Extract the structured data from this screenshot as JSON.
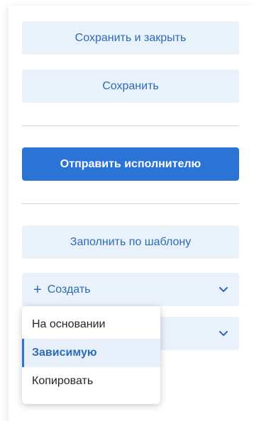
{
  "actions": {
    "save_close_label": "Сохранить и закрыть",
    "save_label": "Сохранить",
    "send_label": "Отправить исполнителю",
    "fill_template_label": "Заполнить по шаблону"
  },
  "create_dropdown": {
    "plus": "+",
    "label": "Создать"
  },
  "second_dropdown": {
    "label": ""
  },
  "create_menu": {
    "items": [
      {
        "label": "На основании"
      },
      {
        "label": "Зависимую"
      },
      {
        "label": "Копировать"
      }
    ],
    "active_index": 1
  },
  "colors": {
    "primary": "#2b74d6",
    "light_button": "#e9f1fb",
    "link_text": "#2c6bb8"
  },
  "icons": {
    "dropdown_indicator": "chevron-down-icon"
  }
}
